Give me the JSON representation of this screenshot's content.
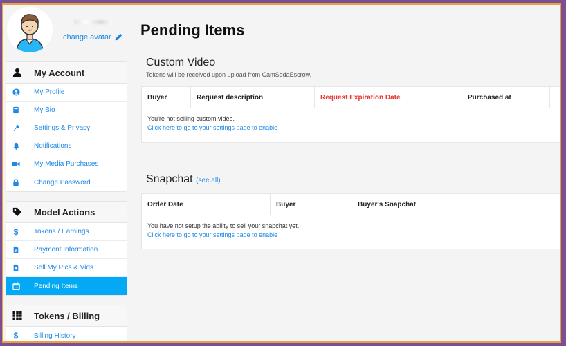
{
  "profile": {
    "change_avatar_label": "change avatar"
  },
  "sidebar": {
    "groups": [
      {
        "title": "My Account",
        "icon": "user-icon",
        "items": [
          {
            "label": "My Profile",
            "icon": "user-circle-icon"
          },
          {
            "label": "My Bio",
            "icon": "book-icon"
          },
          {
            "label": "Settings & Privacy",
            "icon": "wrench-icon"
          },
          {
            "label": "Notifications",
            "icon": "bell-icon"
          },
          {
            "label": "My Media Purchases",
            "icon": "video-camera-icon"
          },
          {
            "label": "Change Password",
            "icon": "lock-icon"
          }
        ]
      },
      {
        "title": "Model Actions",
        "icon": "tag-icon",
        "items": [
          {
            "label": "Tokens / Earnings",
            "icon": "dollar-icon"
          },
          {
            "label": "Payment Information",
            "icon": "file-invoice-icon"
          },
          {
            "label": "Sell My Pics & Vids",
            "icon": "file-image-icon"
          },
          {
            "label": "Pending Items",
            "icon": "calendar-icon",
            "active": true
          }
        ]
      },
      {
        "title": "Tokens / Billing",
        "icon": "grid-icon",
        "items": [
          {
            "label": "Billing History",
            "icon": "dollar-icon"
          }
        ]
      }
    ]
  },
  "main": {
    "page_title": "Pending Items",
    "custom_video": {
      "title": "Custom Video",
      "subtitle": "Tokens will be received upon upload from CamSodaEscrow.",
      "columns": [
        "Buyer",
        "Request description",
        "Request Expiration Date",
        "Purchased at",
        ""
      ],
      "message": "You're not selling custom video.",
      "link": "Click here to go to your settings page to enable"
    },
    "snapchat": {
      "title": "Snapchat",
      "see_all": "(see all)",
      "columns": [
        "Order Date",
        "Buyer",
        "Buyer's Snapchat",
        ""
      ],
      "message": "You have not setup the ability to sell your snapchat yet.",
      "link": "Click here to go to your settings page to enable"
    }
  },
  "colors": {
    "accent": "#1e88e5",
    "active_item": "#03a9f4",
    "warning_header": "#e53935",
    "outer_background": "#7a4f96",
    "frame_border": "#e8a33c"
  }
}
